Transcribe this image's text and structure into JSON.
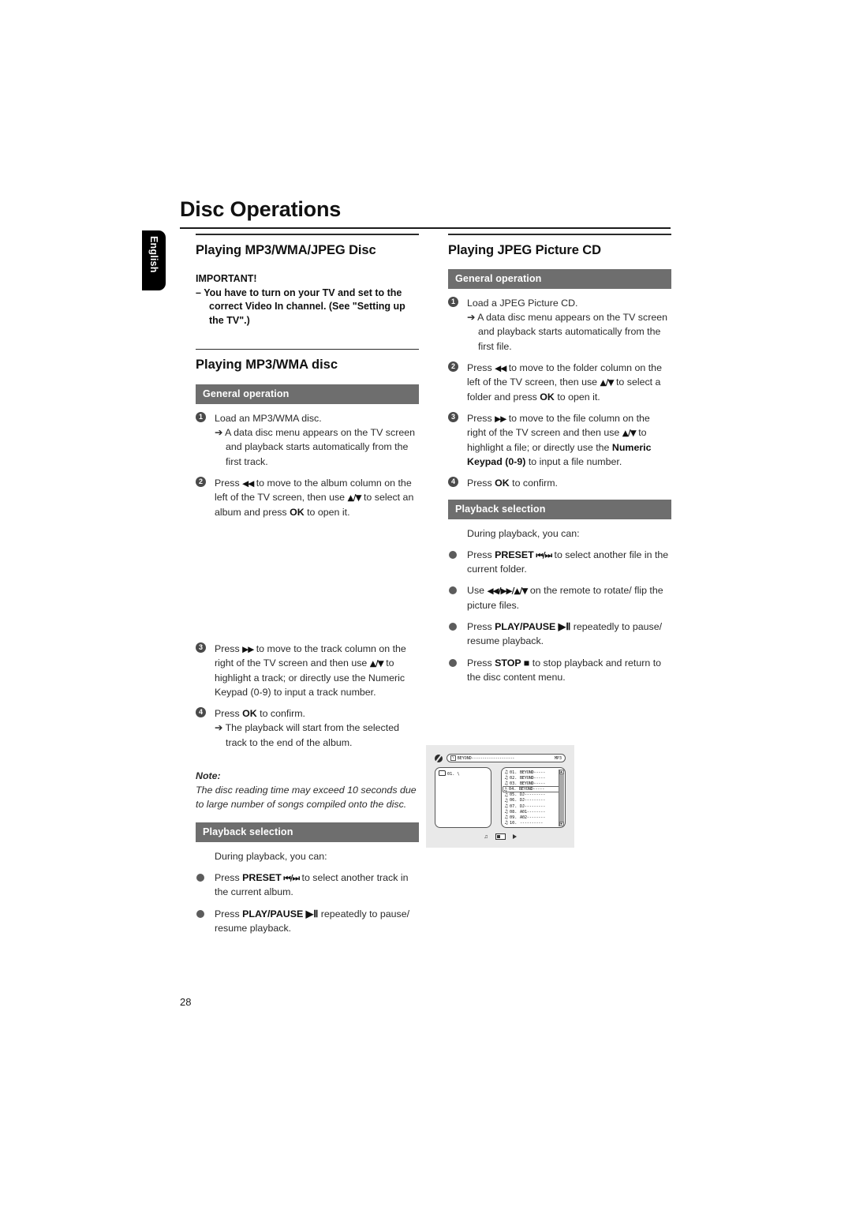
{
  "page": {
    "title": "Disc Operations",
    "number": "28",
    "language_tab": "English"
  },
  "left_column": {
    "heading": "Playing MP3/WMA/JPEG Disc",
    "important": {
      "label": "IMPORTANT!",
      "line": "–   You have to turn on your TV and set to the correct Video In channel. (See \"Setting up the TV\".)"
    },
    "subheading": "Playing MP3/WMA disc",
    "general_bar": "General operation",
    "steps": [
      {
        "num": "1",
        "text": "Load an MP3/WMA disc.",
        "arrow": "➔ A data disc menu appears on the TV screen and playback starts automatically from the first track."
      },
      {
        "num": "2",
        "text_parts": [
          "Press ",
          "◀◀",
          " to move to the album column on the left of the TV screen, then use ",
          "▲/▼",
          " to select an album and press ",
          "OK",
          " to open it."
        ]
      },
      {
        "num": "3",
        "text_parts": [
          "Press ",
          "▶▶",
          " to move to the track column on the right of the TV screen and then use ",
          "▲/▼",
          " to highlight a track; or directly use the Numeric Keypad (0-9) to input a track number."
        ]
      },
      {
        "num": "4",
        "text_parts": [
          "Press ",
          "OK",
          " to confirm."
        ],
        "arrow": "➔ The playback will start from the selected track to the end of the album."
      }
    ],
    "note": {
      "label": "Note:",
      "text": "The disc reading time may exceed 10 seconds due to large number of songs compiled onto the disc."
    },
    "playback_bar": "Playback selection",
    "playback_intro": "During playback, you can:",
    "playback_items": [
      {
        "parts": [
          "Press ",
          "PRESET",
          "  ⏮/⏭",
          " to select another track in the current album."
        ]
      },
      {
        "parts": [
          "Press ",
          "PLAY/PAUSE ▶Ⅱ",
          " repeatedly to pause/ resume playback."
        ]
      }
    ]
  },
  "right_column": {
    "heading": "Playing JPEG Picture CD",
    "general_bar": "General operation",
    "steps": [
      {
        "num": "1",
        "text": "Load a JPEG Picture CD.",
        "arrow": "➔ A data disc menu appears on the TV screen and playback starts automatically from the first file."
      },
      {
        "num": "2",
        "text_parts": [
          "Press ",
          "◀◀",
          " to move to the folder column on the left of the TV screen, then use ",
          "▲/▼",
          " to select a folder and press ",
          "OK",
          " to open it."
        ]
      },
      {
        "num": "3",
        "text_parts": [
          "Press ",
          "▶▶",
          " to move to the file column on the right of the TV screen and then use ",
          "▲/▼",
          " to highlight a file; or directly use the ",
          "Numeric Keypad (0-9)",
          " to input a file number."
        ]
      },
      {
        "num": "4",
        "text_parts": [
          "Press ",
          "OK",
          " to confirm."
        ]
      }
    ],
    "playback_bar": "Playback selection",
    "playback_intro": "During playback, you can:",
    "playback_items": [
      {
        "parts": [
          "Press ",
          "PRESET",
          "  ⏮/⏭",
          " to select another file in the current folder."
        ]
      },
      {
        "parts": [
          "Use ",
          "◀◀/▶▶/▲/▼",
          " on the remote to rotate/ flip the picture files."
        ]
      },
      {
        "parts": [
          "Press ",
          "PLAY/PAUSE ▶Ⅱ",
          " repeatedly to pause/ resume playback."
        ]
      },
      {
        "parts": [
          "Press ",
          "STOP ■",
          " to stop playback and return to the disc content menu."
        ]
      }
    ]
  },
  "illustration": {
    "header_label": "BEYOND",
    "header_dashes": "--------------------",
    "header_type": "MP3",
    "folder_label": "01.  \\",
    "tracks": [
      {
        "num": "01.",
        "name": "BEYOND-----",
        "selected": false
      },
      {
        "num": "02.",
        "name": "BEYOND-----",
        "selected": false
      },
      {
        "num": "03.",
        "name": "BEYOND-----",
        "selected": false
      },
      {
        "num": "04.",
        "name": "BEYOND-----",
        "selected": true
      },
      {
        "num": "05.",
        "name": "DJ---------",
        "selected": false
      },
      {
        "num": "06.",
        "name": "DJ---------",
        "selected": false
      },
      {
        "num": "07.",
        "name": "DJ---------",
        "selected": false
      },
      {
        "num": "08.",
        "name": "A01--------",
        "selected": false
      },
      {
        "num": "09.",
        "name": "A02--------",
        "selected": false
      },
      {
        "num": "10.",
        "name": "----------",
        "selected": false
      }
    ],
    "scroll_up": "▲",
    "scroll_down": "▼"
  },
  "colors": {
    "bar_gray": "#6e6e6e",
    "bullet_gray": "#4a4a4a",
    "text": "#2b2b2b",
    "heading": "#111111",
    "screen_bg": "#e9e9e9"
  }
}
